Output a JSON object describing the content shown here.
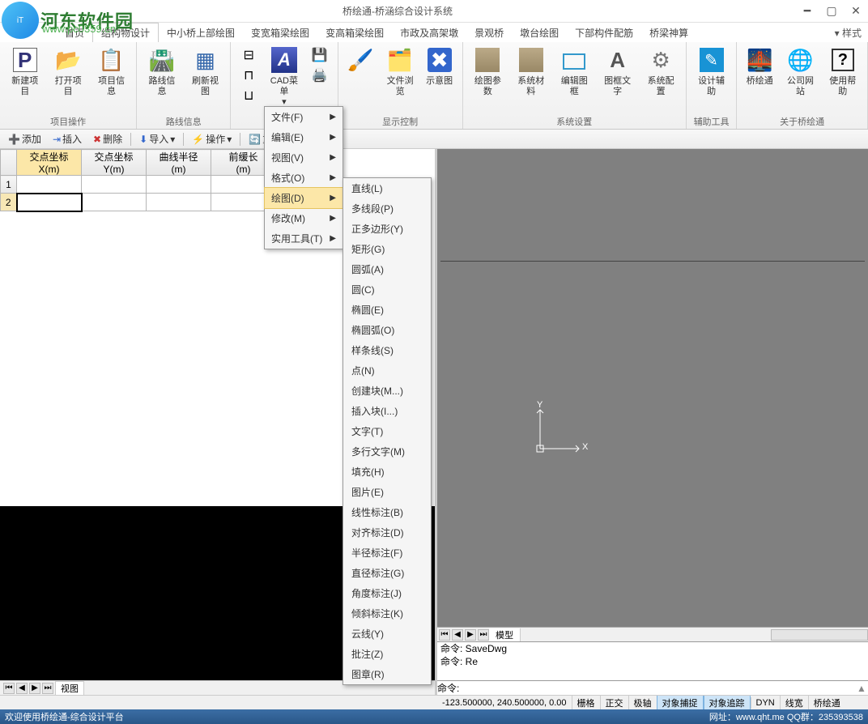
{
  "window": {
    "title": "桥绘通-桥涵综合设计系统"
  },
  "watermark": {
    "text": "河东软件园",
    "url": "www.pc0359.cn"
  },
  "tabs": {
    "items": [
      "首页",
      "结构物设计",
      "中小桥上部绘图",
      "变宽箱梁绘图",
      "变高箱梁绘图",
      "市政及高架墩",
      "景观桥",
      "墩台绘图",
      "下部构件配筋",
      "桥梁神算"
    ],
    "style_label": "样式"
  },
  "ribbon": {
    "groups": [
      {
        "title": "项目操作",
        "buttons": [
          {
            "name": "new-project",
            "label": "新建项目"
          },
          {
            "name": "open-project",
            "label": "打开项目"
          },
          {
            "name": "project-info",
            "label": "项目信息"
          }
        ]
      },
      {
        "title": "路线信息",
        "buttons": [
          {
            "name": "route-info",
            "label": "路线信息"
          },
          {
            "name": "refresh-view",
            "label": "刷新视图"
          }
        ]
      },
      {
        "title": "",
        "buttons": [
          {
            "name": "cad-menu",
            "label": "CAD菜单"
          }
        ],
        "small_icons": true
      },
      {
        "title": "显示控制",
        "buttons": [
          {
            "name": "file-browse",
            "label": "文件浏览"
          },
          {
            "name": "schematic",
            "label": "示意图"
          }
        ]
      },
      {
        "title": "系统设置",
        "buttons": [
          {
            "name": "draw-params",
            "label": "绘图参数"
          },
          {
            "name": "sys-material",
            "label": "系统材料"
          },
          {
            "name": "edit-frame",
            "label": "编辑图框"
          },
          {
            "name": "frame-text",
            "label": "图框文字"
          },
          {
            "name": "sys-config",
            "label": "系统配置"
          }
        ]
      },
      {
        "title": "辅助工具",
        "buttons": [
          {
            "name": "design-aid",
            "label": "设计辅助"
          }
        ]
      },
      {
        "title": "关于桥绘通",
        "buttons": [
          {
            "name": "app-home",
            "label": "桥绘通"
          },
          {
            "name": "company-site",
            "label": "公司网站"
          },
          {
            "name": "use-help",
            "label": "使用帮助"
          }
        ]
      }
    ]
  },
  "toolbar": {
    "add": "添加",
    "insert": "插入",
    "delete": "删除",
    "import": "导入",
    "operate": "操作",
    "redraw": "重绘"
  },
  "table": {
    "headers": [
      "交点坐标\nX(m)",
      "交点坐标\nY(m)",
      "曲线半径\n(m)",
      "前缓长\n(m)"
    ],
    "rows": [
      {
        "n": "1"
      },
      {
        "n": "2"
      }
    ]
  },
  "view_nav": {
    "label": "视图"
  },
  "cad_menu": {
    "items": [
      {
        "label": "文件(F)"
      },
      {
        "label": "编辑(E)"
      },
      {
        "label": "视图(V)"
      },
      {
        "label": "格式(O)"
      },
      {
        "label": "绘图(D)",
        "hl": true
      },
      {
        "label": "修改(M)"
      },
      {
        "label": "实用工具(T)"
      }
    ]
  },
  "draw_submenu": {
    "items": [
      "直线(L)",
      "多线段(P)",
      "正多边形(Y)",
      "矩形(G)",
      "圆弧(A)",
      "圆(C)",
      "椭圆(E)",
      "椭圆弧(O)",
      "样条线(S)",
      "点(N)",
      "创建块(M...)",
      "插入块(I...)",
      "文字(T)",
      "多行文字(M)",
      "填充(H)",
      "图片(E)",
      "线性标注(B)",
      "对齐标注(D)",
      "半径标注(F)",
      "直径标注(G)",
      "角度标注(J)",
      "倾斜标注(K)",
      "云线(Y)",
      "批注(Z)",
      "图章(R)"
    ]
  },
  "bot_tabs": {
    "model": "模型"
  },
  "cmd": {
    "hist": [
      "命令: SaveDwg",
      "命令: Re"
    ],
    "prompt": "命令: "
  },
  "coordbar": {
    "coords": "-123.500000, 240.500000, 0.00",
    "stats": [
      "栅格",
      "正交",
      "极轴",
      "对象捕捉",
      "对象追踪",
      "DYN",
      "线宽",
      "桥绘通"
    ],
    "on_idx": [
      3,
      4
    ]
  },
  "footer": {
    "left": "欢迎使用桥绘通-综合设计平台",
    "right": "网址：www.qht.me QQ群：235393538"
  },
  "axis": {
    "x": "X",
    "y": "Y"
  }
}
